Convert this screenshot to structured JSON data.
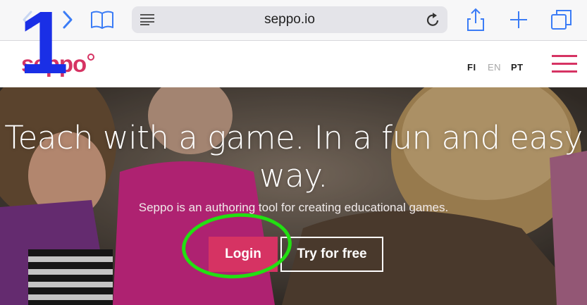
{
  "browser": {
    "url": "seppo.io",
    "icons": {
      "back": "chevron-left-icon",
      "forward": "chevron-right-icon",
      "bookmarks": "book-icon",
      "reader": "reader-lines-icon",
      "reload": "reload-icon",
      "share": "share-icon",
      "new_tab": "plus-icon",
      "tabs": "tabs-icon"
    },
    "accent": "#3b7cf6"
  },
  "site": {
    "logo": "seppo",
    "languages": [
      "FI",
      "EN",
      "PT"
    ],
    "active_languages": [
      "FI",
      "PT"
    ],
    "brand_color": "#d63363",
    "menu_icon": "hamburger-menu-icon"
  },
  "hero": {
    "title": "Teach with a game. In a fun and easy way.",
    "subtitle": "Seppo is an authoring tool for creating educational games.",
    "login_label": "Login",
    "try_label": "Try for free"
  },
  "annotation": {
    "step_number": "1",
    "number_color": "#1a2fe6",
    "ring_color": "#22e012"
  }
}
